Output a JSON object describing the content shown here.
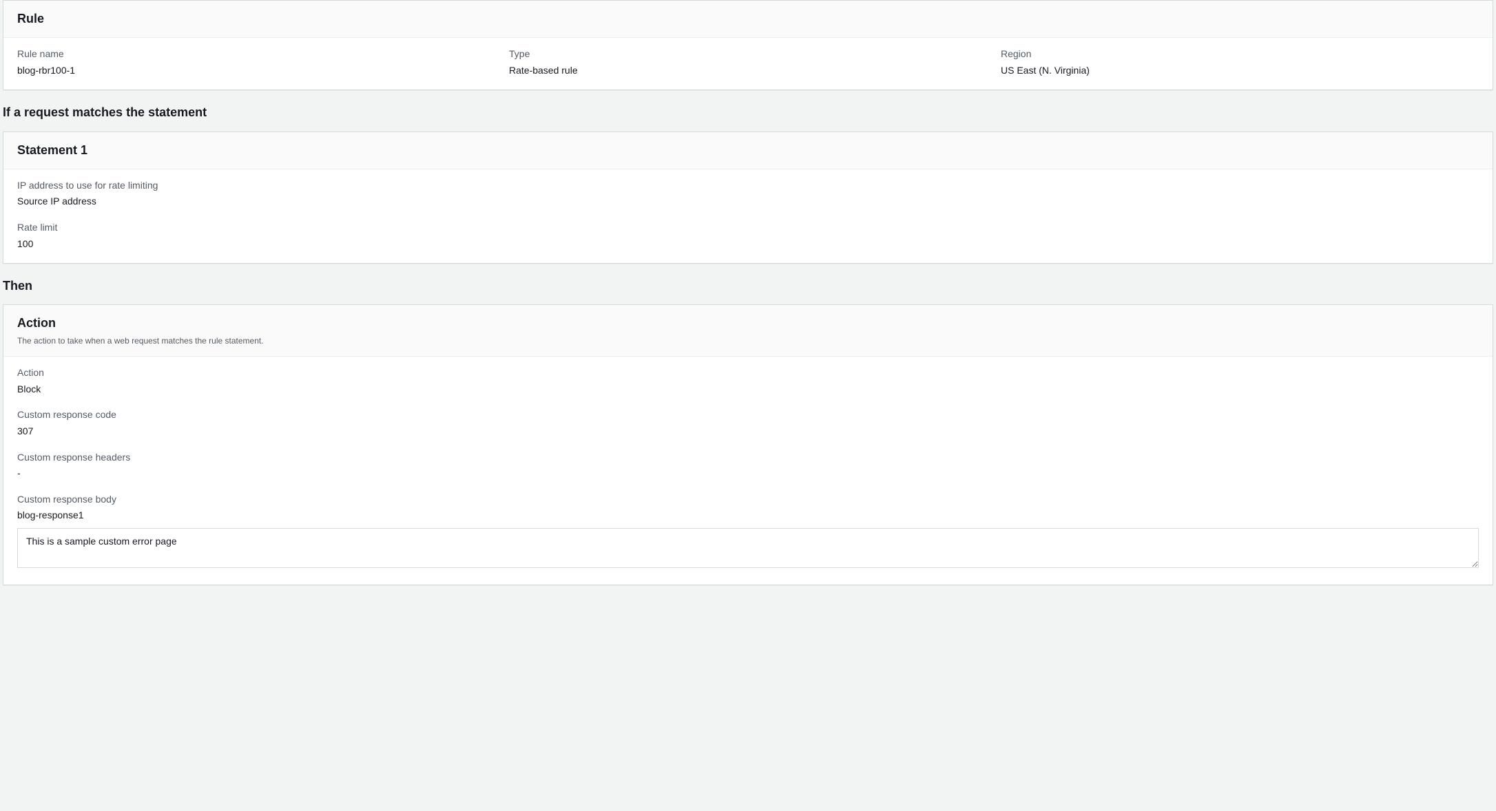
{
  "rule": {
    "header": "Rule",
    "name_label": "Rule name",
    "name_value": "blog-rbr100-1",
    "type_label": "Type",
    "type_value": "Rate-based rule",
    "region_label": "Region",
    "region_value": "US East (N. Virginia)"
  },
  "condition_section_title": "If a request matches the statement",
  "statement": {
    "header": "Statement 1",
    "ip_label": "IP address to use for rate limiting",
    "ip_value": "Source IP address",
    "rate_label": "Rate limit",
    "rate_value": "100"
  },
  "then_section_title": "Then",
  "action": {
    "header": "Action",
    "description": "The action to take when a web request matches the rule statement.",
    "action_label": "Action",
    "action_value": "Block",
    "code_label": "Custom response code",
    "code_value": "307",
    "headers_label": "Custom response headers",
    "headers_value": "-",
    "body_label": "Custom response body",
    "body_value": "blog-response1",
    "body_content": "This is a sample custom error page"
  }
}
